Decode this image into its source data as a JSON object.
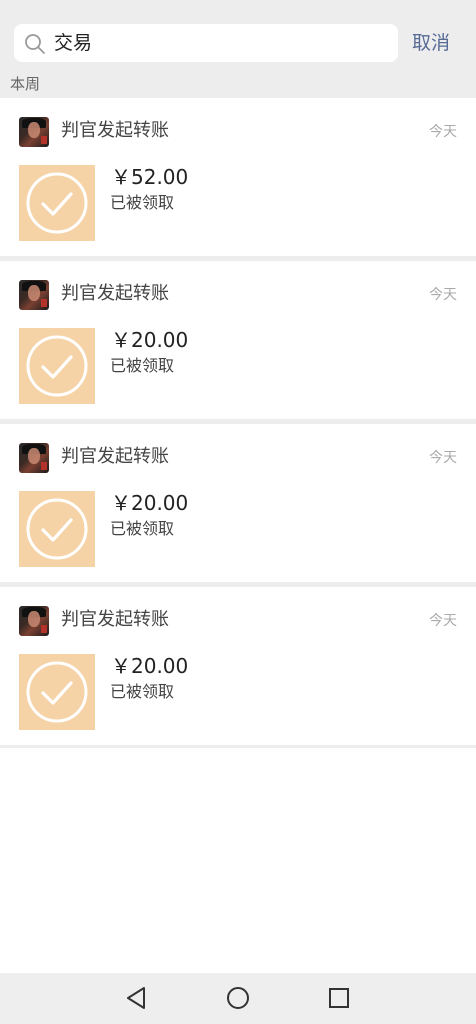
{
  "search": {
    "query": "交易"
  },
  "header": {
    "cancel_label": "取消"
  },
  "section": {
    "label": "本周"
  },
  "transactions": [
    {
      "sender": "判官发起转账",
      "time": "今天",
      "amount": "￥52.00",
      "status": "已被领取"
    },
    {
      "sender": "判官发起转账",
      "time": "今天",
      "amount": "￥20.00",
      "status": "已被领取"
    },
    {
      "sender": "判官发起转账",
      "time": "今天",
      "amount": "￥20.00",
      "status": "已被领取"
    },
    {
      "sender": "判官发起转账",
      "time": "今天",
      "amount": "￥20.00",
      "status": "已被领取"
    }
  ],
  "colors": {
    "accent": "#576b95",
    "thumb_bg": "#f6d3a7",
    "page_bg": "#ededed"
  },
  "icons": {
    "search": "search-icon",
    "check": "check-circle-icon",
    "back": "triangle-back-icon",
    "home": "circle-home-icon",
    "recents": "square-recents-icon"
  }
}
